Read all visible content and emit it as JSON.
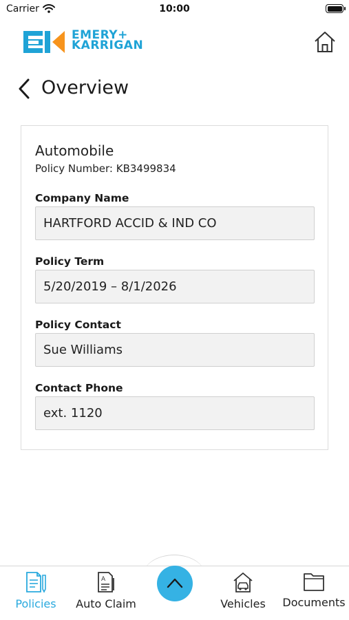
{
  "status_bar": {
    "carrier": "Carrier",
    "time": "10:00"
  },
  "header": {
    "logo_line1": "EMERY+",
    "logo_line2": "KARRIGAN",
    "brand_color": "#1fa3d6",
    "accent_color": "#f7941d"
  },
  "page": {
    "title": "Overview"
  },
  "policy": {
    "type": "Automobile",
    "number_label": "Policy Number:",
    "number": "KB3499834",
    "fields": [
      {
        "label": "Company Name",
        "value": "HARTFORD ACCID & IND CO"
      },
      {
        "label": "Policy Term",
        "value": "5/20/2019 – 8/1/2026"
      },
      {
        "label": "Policy Contact",
        "value": "Sue Williams"
      },
      {
        "label": "Contact Phone",
        "value": "ext. 1120"
      }
    ]
  },
  "tabs": [
    {
      "label": "Policies",
      "icon": "policies-icon",
      "active": true
    },
    {
      "label": "Auto Claim",
      "icon": "auto-claim-icon",
      "active": false
    },
    {
      "label": "Vehicles",
      "icon": "vehicles-icon",
      "active": false
    },
    {
      "label": "Documents",
      "icon": "documents-icon",
      "active": false
    }
  ],
  "colors": {
    "active_tab": "#29a9de",
    "fab": "#35b2e4"
  }
}
